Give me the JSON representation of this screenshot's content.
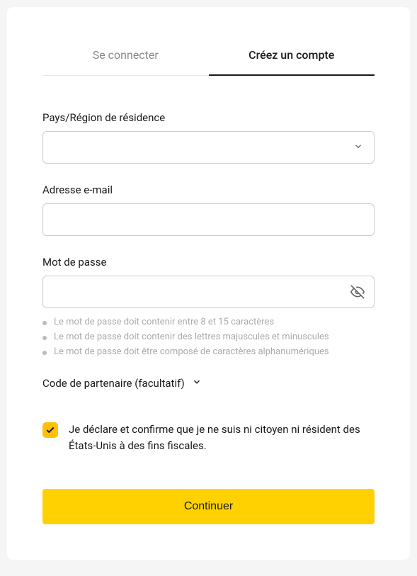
{
  "tabs": {
    "login": "Se connecter",
    "signup": "Créez un compte"
  },
  "form": {
    "country": {
      "label": "Pays/Région de résidence",
      "value": ""
    },
    "email": {
      "label": "Adresse e-mail",
      "value": ""
    },
    "password": {
      "label": "Mot de passe",
      "value": "",
      "hints": [
        "Le mot de passe doit contenir entre 8 et 15 caractères",
        "Le mot de passe doit contenir des lettres majuscules et minuscules",
        "Le mot de passe doit être composé de caractères alphanumériques"
      ]
    },
    "partner_code": {
      "label": "Code de partenaire (facultatif)"
    },
    "declaration": {
      "checked": true,
      "text": "Je déclare et confirme que je ne suis ni citoyen ni résident des États-Unis à des fins fiscales."
    },
    "submit": "Continuer"
  }
}
